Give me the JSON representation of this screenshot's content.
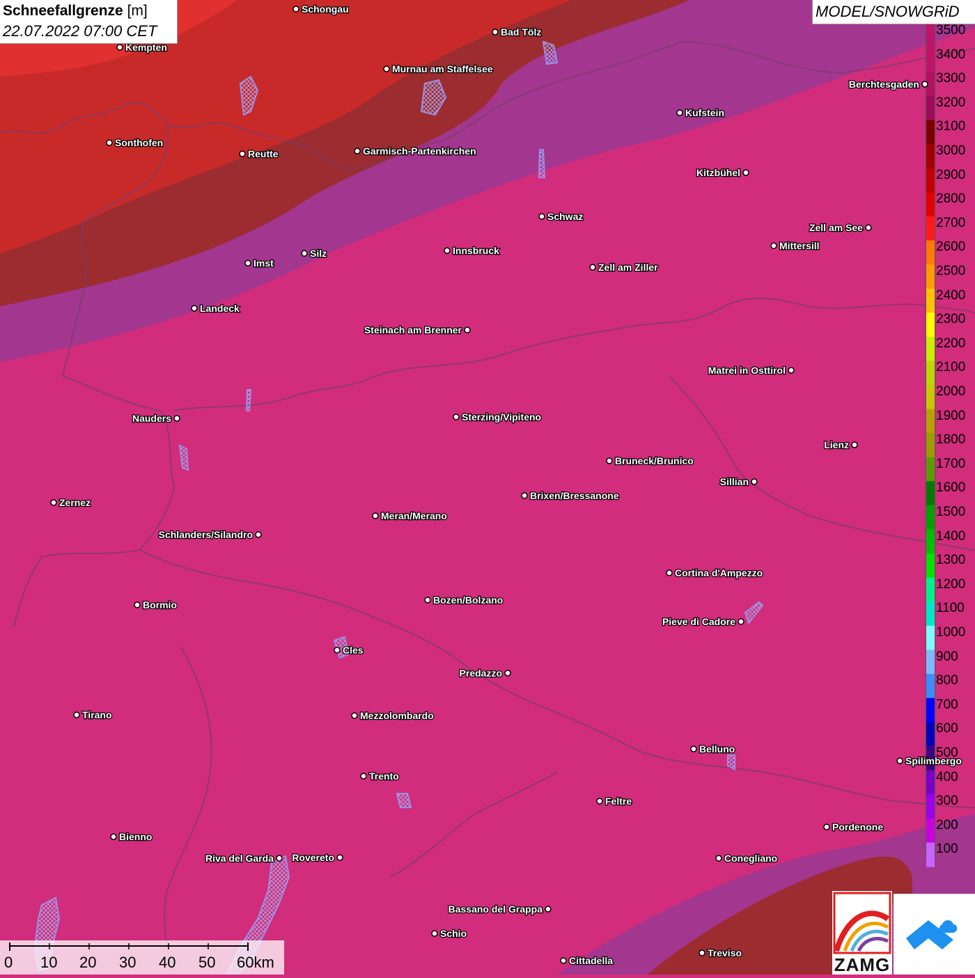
{
  "header": {
    "title": "Schneefallgrenze",
    "unit": "[m]",
    "datetime": "22.07.2022 07:00 CET",
    "model": "MODEL/SNOWGRiD"
  },
  "legend": {
    "levels": [
      {
        "value": "3500",
        "color": "#c0146b"
      },
      {
        "value": "3400",
        "color": "#c0146b"
      },
      {
        "value": "3300",
        "color": "#b01262"
      },
      {
        "value": "3200",
        "color": "#9c0c5a"
      },
      {
        "value": "3100",
        "color": "#7a0000"
      },
      {
        "value": "3000",
        "color": "#a30000"
      },
      {
        "value": "2900",
        "color": "#c40000"
      },
      {
        "value": "2800",
        "color": "#e00000"
      },
      {
        "value": "2700",
        "color": "#ff1a1a"
      },
      {
        "value": "2600",
        "color": "#ff7a00"
      },
      {
        "value": "2500",
        "color": "#ff9a00"
      },
      {
        "value": "2400",
        "color": "#ffc200"
      },
      {
        "value": "2300",
        "color": "#ffff00"
      },
      {
        "value": "2200",
        "color": "#c8ef00"
      },
      {
        "value": "2100",
        "color": "#b8d800"
      },
      {
        "value": "2000",
        "color": "#c8c800"
      },
      {
        "value": "1900",
        "color": "#b8a000"
      },
      {
        "value": "1800",
        "color": "#9c9c00"
      },
      {
        "value": "1700",
        "color": "#5a9c00"
      },
      {
        "value": "1600",
        "color": "#007a00"
      },
      {
        "value": "1500",
        "color": "#00a000"
      },
      {
        "value": "1400",
        "color": "#00bc00"
      },
      {
        "value": "1300",
        "color": "#00e000"
      },
      {
        "value": "1200",
        "color": "#00f08c"
      },
      {
        "value": "1100",
        "color": "#00e8c8"
      },
      {
        "value": "1000",
        "color": "#80f8ff"
      },
      {
        "value": "900",
        "color": "#80b8ff"
      },
      {
        "value": "800",
        "color": "#3c8cff"
      },
      {
        "value": "700",
        "color": "#0000ff"
      },
      {
        "value": "600",
        "color": "#0000b8"
      },
      {
        "value": "500",
        "color": "#3c0080"
      },
      {
        "value": "400",
        "color": "#7a00c8"
      },
      {
        "value": "300",
        "color": "#9c00e8"
      },
      {
        "value": "200",
        "color": "#c800e0"
      },
      {
        "value": "100",
        "color": "#c864ff"
      }
    ]
  },
  "scalebar": {
    "labels": [
      "0",
      "10",
      "20",
      "30",
      "40",
      "50",
      "60km"
    ]
  },
  "zones": {
    "main_color": "#d12d7c",
    "purple_color": "#a3368f",
    "darkred_color": "#9c2c30",
    "red_color": "#c82a2a",
    "brightred_color": "#e03030"
  },
  "places": [
    {
      "name": "Schongau",
      "align": "left"
    },
    {
      "name": "Bad Tölz",
      "align": "left"
    },
    {
      "name": "Kempten",
      "align": "left"
    },
    {
      "name": "Murnau am Staffelsee",
      "align": "left"
    },
    {
      "name": "Berchtesgaden",
      "align": "right"
    },
    {
      "name": "Kufstein",
      "align": "left"
    },
    {
      "name": "Sonthofen",
      "align": "left"
    },
    {
      "name": "Reutte",
      "align": "left"
    },
    {
      "name": "Garmisch-Partenkirchen",
      "align": "left"
    },
    {
      "name": "Kitzbühel",
      "align": "right"
    },
    {
      "name": "Schwaz",
      "align": "left"
    },
    {
      "name": "Zell am See",
      "align": "right"
    },
    {
      "name": "Mittersill",
      "align": "left"
    },
    {
      "name": "Innsbruck",
      "align": "left"
    },
    {
      "name": "Silz",
      "align": "left"
    },
    {
      "name": "Imst",
      "align": "left"
    },
    {
      "name": "Zell am Ziller",
      "align": "left"
    },
    {
      "name": "Landeck",
      "align": "left"
    },
    {
      "name": "Steinach am Brenner",
      "align": "right"
    },
    {
      "name": "Matrei in Osttirol",
      "align": "right"
    },
    {
      "name": "Nauders",
      "align": "right"
    },
    {
      "name": "Sterzing/Vipiteno",
      "align": "left"
    },
    {
      "name": "Lienz",
      "align": "right"
    },
    {
      "name": "Bruneck/Brunico",
      "align": "left"
    },
    {
      "name": "Sillian",
      "align": "right"
    },
    {
      "name": "Zernez",
      "align": "left"
    },
    {
      "name": "Brixen/Bressanone",
      "align": "left"
    },
    {
      "name": "Meran/Merano",
      "align": "left"
    },
    {
      "name": "Schlanders/Silandro",
      "align": "right"
    },
    {
      "name": "Cortina d'Ampezzo",
      "align": "left"
    },
    {
      "name": "Bormio",
      "align": "left"
    },
    {
      "name": "Bozen/Bolzano",
      "align": "left"
    },
    {
      "name": "Pieve di Cadore",
      "align": "right"
    },
    {
      "name": "Cles",
      "align": "left"
    },
    {
      "name": "Predazzo",
      "align": "right"
    },
    {
      "name": "Tirano",
      "align": "left"
    },
    {
      "name": "Mezzolombardo",
      "align": "left"
    },
    {
      "name": "Belluno",
      "align": "left"
    },
    {
      "name": "Spilimbergo",
      "align": "left"
    },
    {
      "name": "Trento",
      "align": "left"
    },
    {
      "name": "Feltre",
      "align": "left"
    },
    {
      "name": "Pordenone",
      "align": "left"
    },
    {
      "name": "Bienno",
      "align": "left"
    },
    {
      "name": "Riva del Garda",
      "align": "right"
    },
    {
      "name": "Rovereto",
      "align": "right"
    },
    {
      "name": "Conegliano",
      "align": "left"
    },
    {
      "name": "Bassano del Grappa",
      "align": "right"
    },
    {
      "name": "Schio",
      "align": "left"
    },
    {
      "name": "Treviso",
      "align": "left"
    },
    {
      "name": "Cittadella",
      "align": "left"
    }
  ],
  "logos": {
    "zamg_text": "ZAMG"
  }
}
